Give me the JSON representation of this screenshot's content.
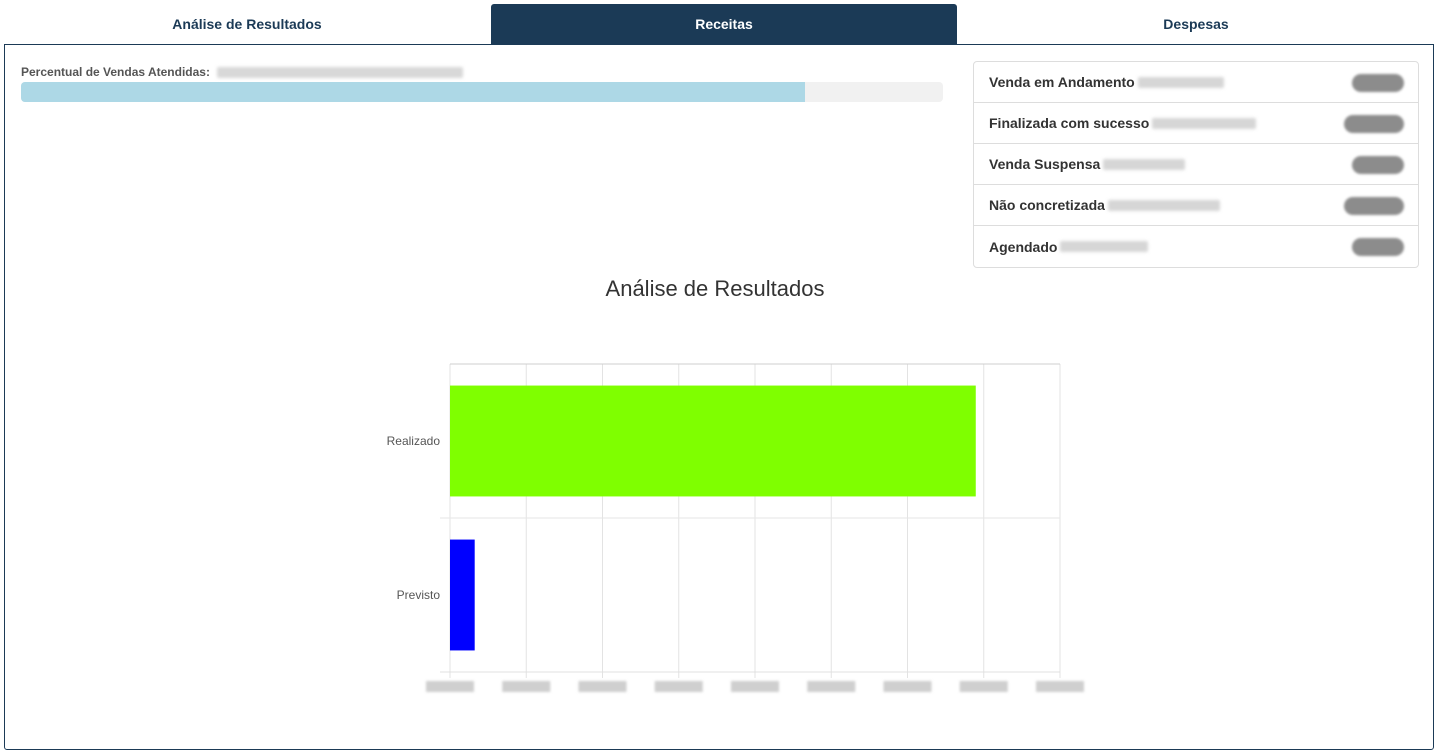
{
  "tabs": [
    {
      "label": "Análise de Resultados",
      "active": false
    },
    {
      "label": "Receitas",
      "active": true
    },
    {
      "label": "Despesas",
      "active": false
    }
  ],
  "progress": {
    "label": "Percentual de Vendas Atendidas:",
    "fraction": 0.85,
    "fill_color": "#add8e6"
  },
  "status_list": [
    {
      "label": "Venda em Andamento"
    },
    {
      "label": "Finalizada com sucesso"
    },
    {
      "label": "Venda Suspensa"
    },
    {
      "label": "Não concretizada"
    },
    {
      "label": "Agendado"
    }
  ],
  "chart_data": {
    "type": "bar",
    "orientation": "horizontal",
    "title": "Análise de Resultados",
    "categories": [
      "Realizado",
      "Previsto"
    ],
    "values": [
      7.24,
      0.34
    ],
    "colors": [
      "#7fff00",
      "#0000ff"
    ],
    "xlim": [
      0,
      8.4
    ],
    "x_tick_count": 9,
    "grid": true,
    "legend": "none"
  },
  "colors": {
    "accent": "#1b3a56"
  }
}
